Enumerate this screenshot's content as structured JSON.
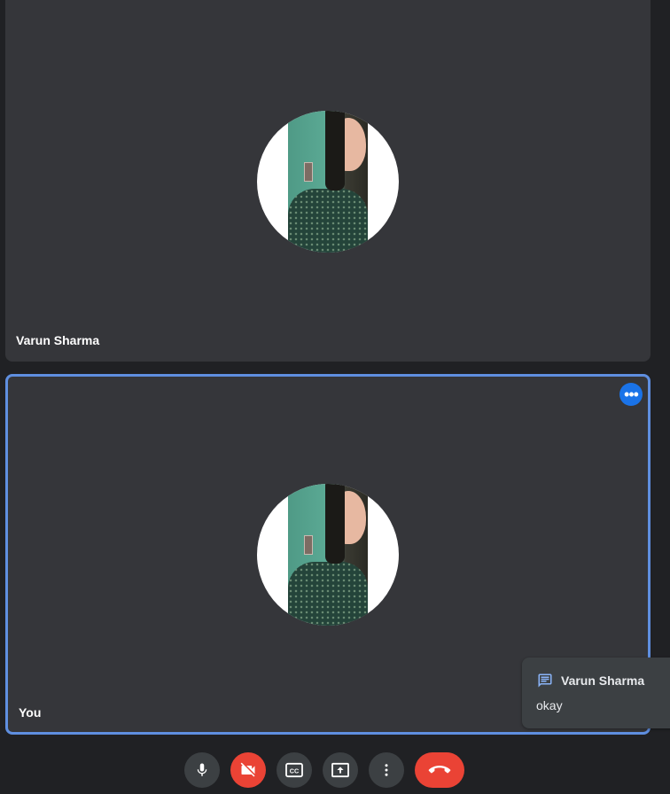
{
  "participants": [
    {
      "name": "Varun Sharma"
    },
    {
      "name": "You"
    }
  ],
  "chat_notification": {
    "sender": "Varun Sharma",
    "message": "okay"
  },
  "controls": {
    "microphone": "mic-icon",
    "camera": "camera-off-icon",
    "captions": "captions-icon",
    "present": "present-screen-icon",
    "more": "more-options-icon",
    "leave": "end-call-icon"
  },
  "colors": {
    "background": "#202124",
    "tile": "#35363a",
    "active_border": "#5f8fe0",
    "danger": "#ea4335",
    "accent": "#1a73e8"
  }
}
